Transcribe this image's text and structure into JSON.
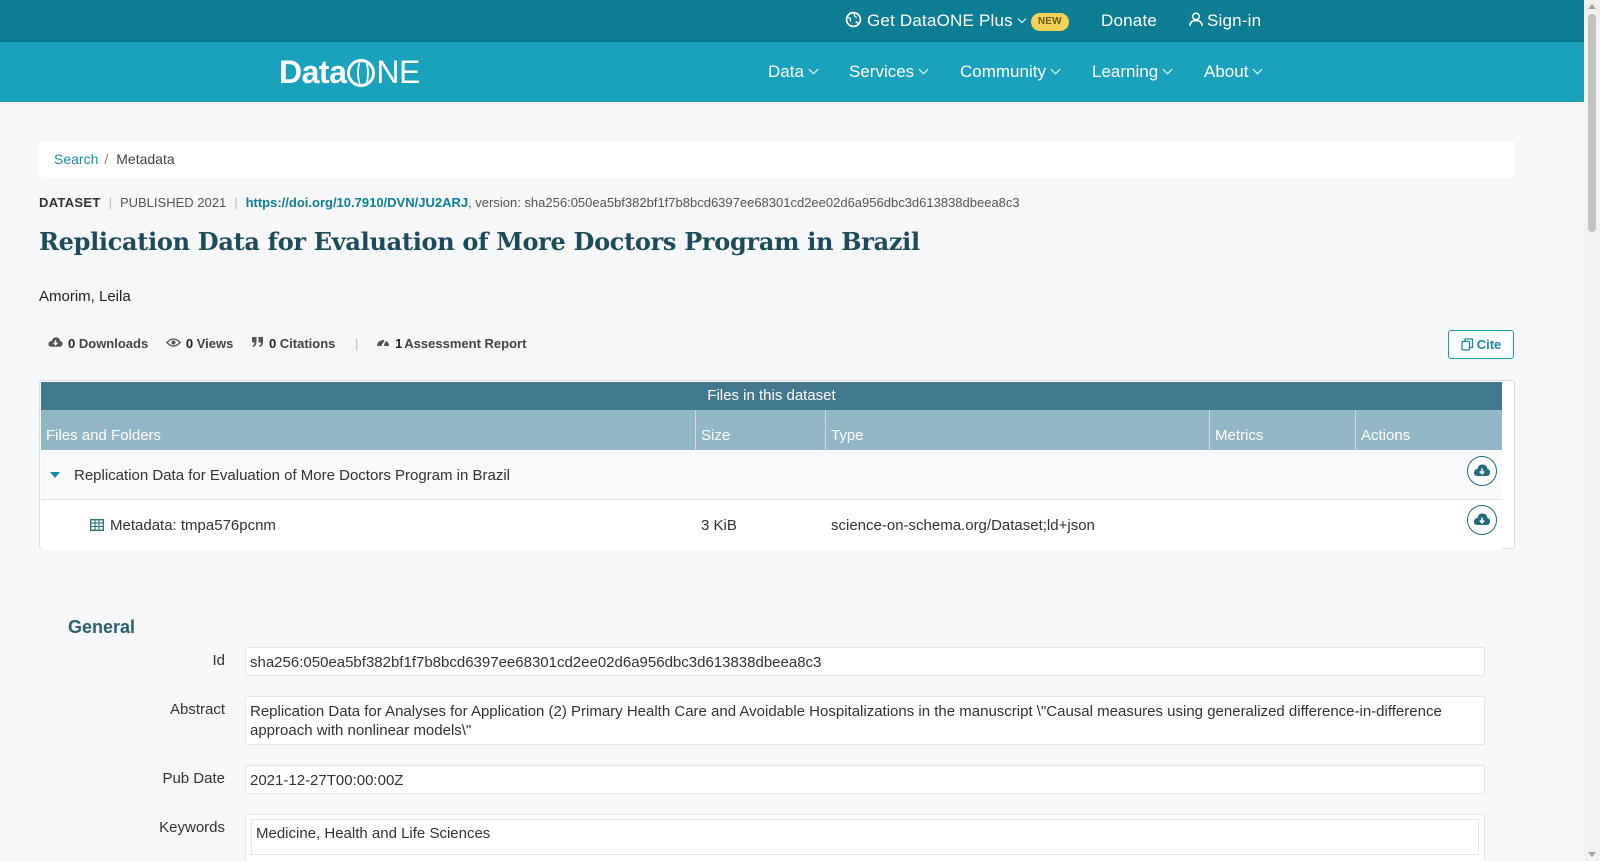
{
  "topbar": {
    "get_plus": "Get DataONE Plus",
    "new_badge": "NEW",
    "donate": "Donate",
    "signin": "Sign-in"
  },
  "nav": {
    "logo_data": "Data",
    "logo_one_o": "O",
    "logo_one_ne": "NE",
    "items": [
      "Data",
      "Services",
      "Community",
      "Learning",
      "About"
    ]
  },
  "breadcrumb": {
    "search": "Search",
    "separator": "/",
    "current": "Metadata"
  },
  "dataset": {
    "type": "DATASET",
    "published": "PUBLISHED 2021",
    "doi": "https://doi.org/10.7910/DVN/JU2ARJ",
    "version": ", version: sha256:050ea5bf382bf1f7b8bcd6397ee68301cd2ee02d6a956dbc3d613838dbeea8c3",
    "title": "Replication Data for Evaluation of More Doctors Program in Brazil",
    "author": "Amorim, Leila"
  },
  "metrics": {
    "downloads_count": "0",
    "downloads_label": "Downloads",
    "views_count": "0",
    "views_label": "Views",
    "citations_count": "0",
    "citations_label": "Citations",
    "assessment_count": "1",
    "assessment_label": "Assessment Report",
    "cite_label": "Cite"
  },
  "files_table": {
    "caption": "Files in this dataset",
    "columns": [
      "Files and Folders",
      "Size",
      "Type",
      "Metrics",
      "Actions"
    ],
    "rows": [
      {
        "name": "Replication Data for Evaluation of More Doctors Program in Brazil",
        "size": "",
        "type": ""
      },
      {
        "name": "Metadata: tmpa576pcnm",
        "size": "3 KiB",
        "type": "science-on-schema.org/Dataset;ld+json"
      }
    ]
  },
  "general": {
    "heading": "General",
    "id_label": "Id",
    "id_value": "sha256:050ea5bf382bf1f7b8bcd6397ee68301cd2ee02d6a956dbc3d613838dbeea8c3",
    "abstract_label": "Abstract",
    "abstract_value": "Replication Data for Analyses for Application (2) Primary Health Care and Avoidable Hospitalizations in the manuscript \\\"Causal measures using generalized difference-in-difference approach with nonlinear models\\\"",
    "pubdate_label": "Pub Date",
    "pubdate_value": "2021-12-27T00:00:00Z",
    "keywords_label": "Keywords",
    "keywords_value": "Medicine, Health and Life Sciences"
  },
  "colors": {
    "topbar": "#0d7d94",
    "navbar": "#1aa1bb",
    "accent": "#1a8aa3",
    "table_caption": "#42788d",
    "table_header": "#93b7c7"
  }
}
